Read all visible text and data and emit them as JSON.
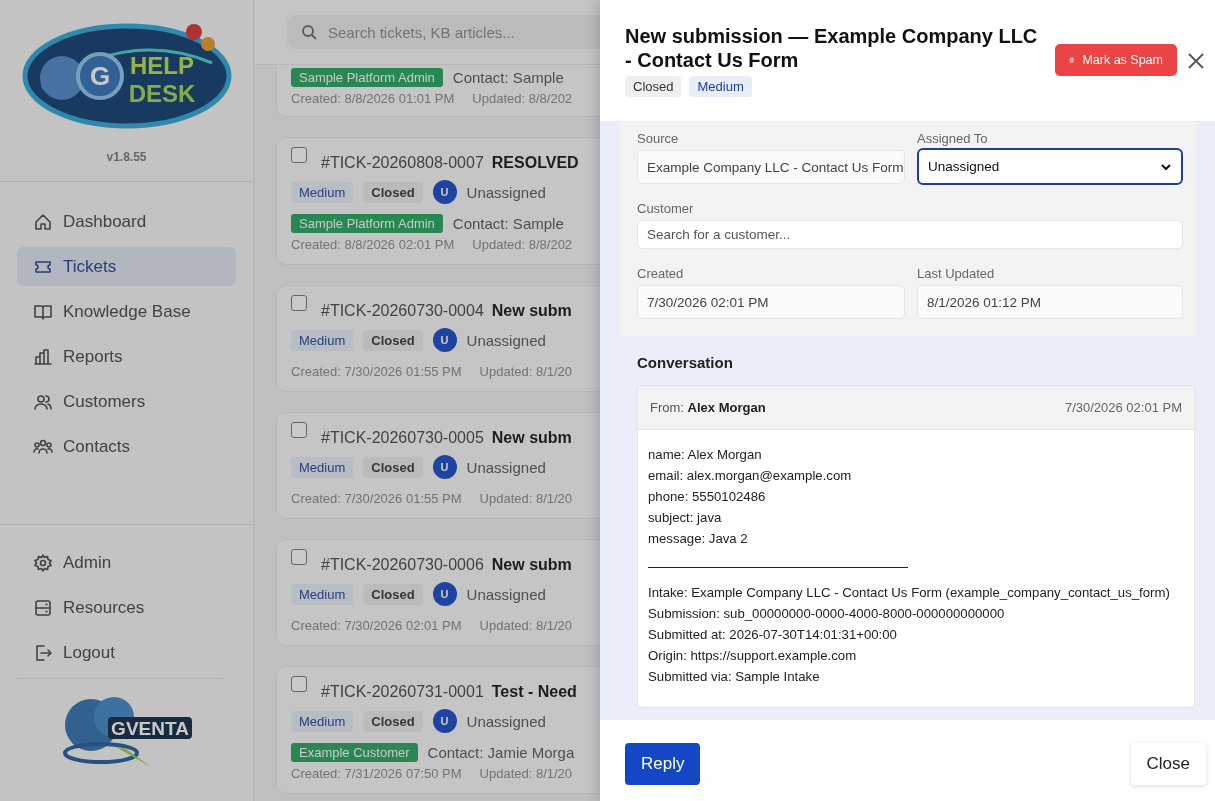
{
  "sidebar": {
    "logo": {
      "letter": "G",
      "line_1": "HELP",
      "line_2": "DESK"
    },
    "version": "v1.8.55",
    "nav_items": [
      {
        "label": "Dashboard",
        "selected": false
      },
      {
        "label": "Tickets",
        "selected": true
      },
      {
        "label": "Knowledge Base",
        "selected": false
      },
      {
        "label": "Reports",
        "selected": false
      },
      {
        "label": "Customers",
        "selected": false
      },
      {
        "label": "Contacts",
        "selected": false
      }
    ],
    "bottom_items": [
      {
        "label": "Admin"
      },
      {
        "label": "Resources"
      },
      {
        "label": "Logout"
      }
    ],
    "footer_logo": {
      "text": "GVENTA"
    }
  },
  "search": {
    "placeholder": "Search tickets, KB articles..."
  },
  "partial_ticket": {
    "tag": "Sample Platform Admin",
    "contact": "Contact: Sample",
    "created": "Created: 8/8/2026 01:01 PM",
    "updated": "Updated: 8/8/202"
  },
  "tickets": [
    {
      "checked": false,
      "id": "#TICK-20260808-0007",
      "title": "RESOLVED",
      "priority": "Medium",
      "status": "Closed",
      "avatar": "U",
      "assignee": "Unassigned",
      "tag": "Sample Platform Admin",
      "contact": "Contact: Sample",
      "created": "Created: 8/8/2026 02:01 PM",
      "updated": "Updated: 8/8/202"
    },
    {
      "checked": false,
      "id": "#TICK-20260730-0004",
      "title": "New subm",
      "priority": "Medium",
      "status": "Closed",
      "avatar": "U",
      "assignee": "Unassigned",
      "created": "Created: 7/30/2026 01:55 PM",
      "updated": "Updated: 8/1/20"
    },
    {
      "checked": false,
      "id": "#TICK-20260730-0005",
      "title": "New subm",
      "priority": "Medium",
      "status": "Closed",
      "avatar": "U",
      "assignee": "Unassigned",
      "created": "Created: 7/30/2026 01:55 PM",
      "updated": "Updated: 8/1/20"
    },
    {
      "checked": false,
      "id": "#TICK-20260730-0006",
      "title": "New subm",
      "priority": "Medium",
      "status": "Closed",
      "avatar": "U",
      "assignee": "Unassigned",
      "created": "Created: 7/30/2026 02:01 PM",
      "updated": "Updated: 8/1/20"
    },
    {
      "checked": false,
      "id": "#TICK-20260731-0001",
      "title": "Test - Need",
      "priority": "Medium",
      "status": "Closed",
      "avatar": "U",
      "assignee": "Unassigned",
      "tag": "Example Customer",
      "contact": "Contact: Jamie Morga",
      "created": "Created: 7/31/2026 07:50 PM",
      "updated": "Updated: 8/1/20"
    }
  ],
  "panel": {
    "title": "New submission — Example Company LLC - Contact Us Form",
    "status": "Closed",
    "priority": "Medium",
    "spam_button": "Mark as Spam",
    "fields": {
      "source_label": "Source",
      "source": "Example Company LLC - Contact Us Form",
      "assigned_label": "Assigned To",
      "assigned": "Unassigned",
      "customer_label": "Customer",
      "customer_placeholder": "Search for a customer...",
      "created_label": "Created",
      "created": "7/30/2026 02:01 PM",
      "updated_label": "Last Updated",
      "updated": "8/1/2026 01:12 PM"
    },
    "conversation": {
      "heading": "Conversation",
      "from_label": "From:",
      "from": "Alex Morgan",
      "date": "7/30/2026 02:01 PM",
      "body_lines": [
        "name: Alex Morgan",
        "email: alex.morgan@example.com",
        "phone: 5550102486",
        "subject: java",
        "message: Java 2"
      ],
      "footer_lines": [
        "Intake: Example Company LLC - Contact Us Form (example_company_contact_us_form)",
        "Submission: sub_00000000-0000-4000-8000-000000000000",
        "Submitted at: 2026-07-30T14:01:31+00:00",
        "Origin: https://support.example.com",
        "Submitted via: Sample Intake"
      ]
    },
    "reply_button": "Reply",
    "close_button": "Close"
  }
}
